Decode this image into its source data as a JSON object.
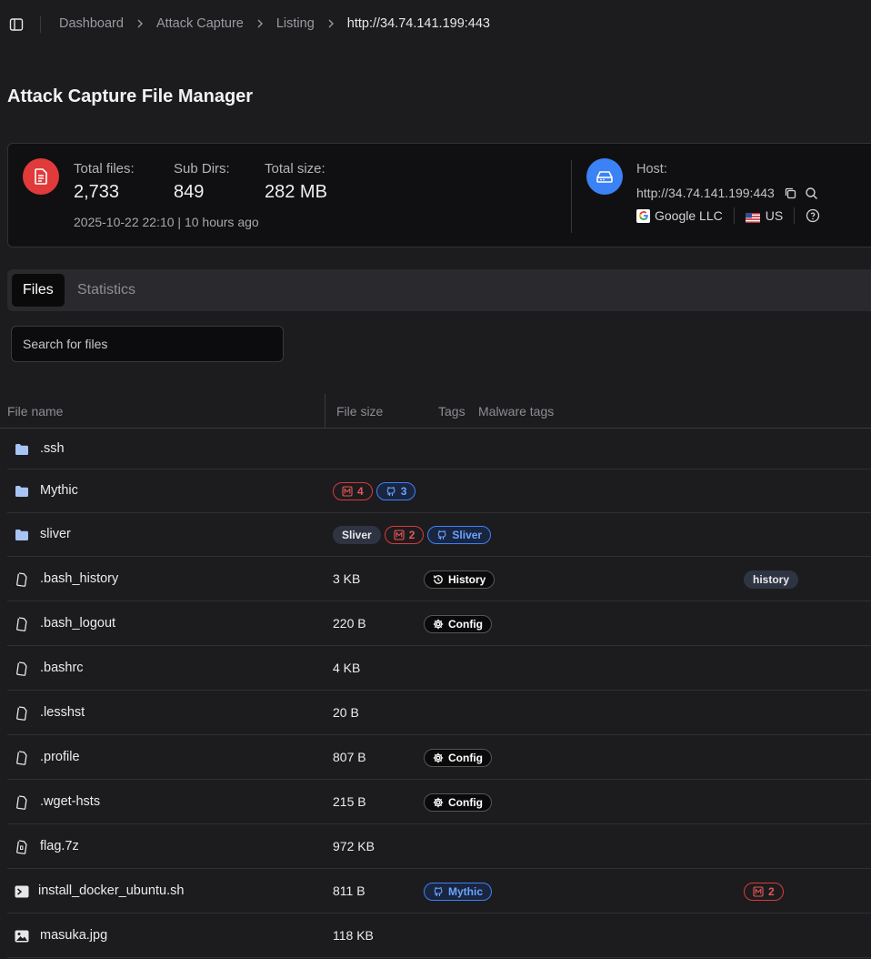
{
  "breadcrumb": [
    "Dashboard",
    "Attack Capture",
    "Listing",
    "http://34.74.141.199:443"
  ],
  "page_title": "Attack Capture File Manager",
  "summary": {
    "total_files_label": "Total files:",
    "total_files": "2,733",
    "sub_dirs_label": "Sub Dirs:",
    "sub_dirs": "849",
    "total_size_label": "Total size:",
    "total_size": "282 MB",
    "date": "2025-10-22 22:10 | 10 hours ago",
    "host_label": "Host:",
    "host_url": "http://34.74.141.199:443",
    "org": "Google LLC",
    "country": "US"
  },
  "tabs": [
    "Files",
    "Statistics"
  ],
  "search": {
    "placeholder": "Search for files"
  },
  "table": {
    "headers": [
      "File name",
      "File size",
      "Tags",
      "Malware tags"
    ],
    "rows": [
      {
        "icon": "folder-icon",
        "name": ".ssh",
        "size": ""
      },
      {
        "icon": "folder-icon",
        "name": "Mythic",
        "size": "",
        "badges": [
          {
            "style": "red",
            "icon": "malware-icon",
            "label": "4"
          },
          {
            "style": "blue",
            "icon": "github-icon",
            "label": "3"
          }
        ]
      },
      {
        "icon": "folder-icon",
        "name": "sliver",
        "size": "",
        "badges": [
          {
            "style": "gray",
            "label": "Sliver"
          },
          {
            "style": "red",
            "icon": "malware-icon",
            "label": "2"
          },
          {
            "style": "blue",
            "icon": "github-icon",
            "label": "Sliver"
          }
        ]
      },
      {
        "icon": "file-icon",
        "name": ".bash_history",
        "size": "3 KB",
        "tags": [
          {
            "style": "dark",
            "icon": "history-icon",
            "label": "History"
          }
        ],
        "malware": [
          {
            "style": "gray",
            "label": "history"
          }
        ]
      },
      {
        "icon": "file-icon",
        "name": ".bash_logout",
        "size": "220 B",
        "tags": [
          {
            "style": "dark",
            "icon": "gear-icon",
            "label": "Config"
          }
        ]
      },
      {
        "icon": "file-icon",
        "name": ".bashrc",
        "size": "4 KB"
      },
      {
        "icon": "file-icon",
        "name": ".lesshst",
        "size": "20 B"
      },
      {
        "icon": "file-icon",
        "name": ".profile",
        "size": "807 B",
        "tags": [
          {
            "style": "dark",
            "icon": "gear-icon",
            "label": "Config"
          }
        ]
      },
      {
        "icon": "file-icon",
        "name": ".wget-hsts",
        "size": "215 B",
        "tags": [
          {
            "style": "dark",
            "icon": "gear-icon",
            "label": "Config"
          }
        ]
      },
      {
        "icon": "archive-icon",
        "name": "flag.7z",
        "size": "972 KB"
      },
      {
        "icon": "terminal-icon",
        "name": "install_docker_ubuntu.sh",
        "size": "811 B",
        "tags": [
          {
            "style": "blue",
            "icon": "github-icon",
            "label": "Mythic"
          }
        ],
        "malware": [
          {
            "style": "red",
            "icon": "malware-icon",
            "label": "2"
          }
        ]
      },
      {
        "icon": "image-icon",
        "name": "masuka.jpg",
        "size": "118 KB"
      }
    ]
  },
  "colors": {
    "background": "#1c1c1f",
    "files_icon_bg": "#e03a3a",
    "host_icon_bg": "#3b82f6",
    "malware_red": "#d93a3a",
    "github_blue": "#3b82f6"
  }
}
